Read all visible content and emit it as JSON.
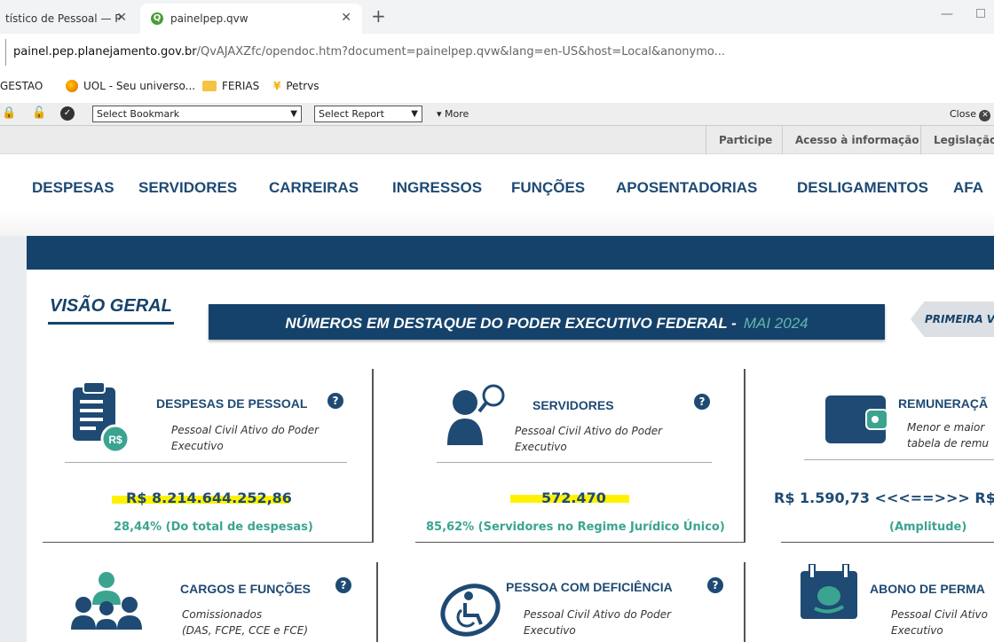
{
  "browser": {
    "tabs": [
      {
        "title": "tístico de Pessoal — P"
      },
      {
        "title": "painelpep.qvw"
      }
    ],
    "url_host": "painel.pep.planejamento.gov.br",
    "url_path": "/QvAJAXZfc/opendoc.htm?document=painelpep.qvw&lang=en-US&host=Local&anonymo...",
    "bookmarks": [
      {
        "label": "GESTAO"
      },
      {
        "label": "UOL - Seu universo..."
      },
      {
        "label": "FERIAS"
      },
      {
        "label": "Petrvs"
      }
    ]
  },
  "qv_toolbar": {
    "bookmark_select": "Select Bookmark",
    "report_select": "Select Report",
    "more": "More",
    "close": "Close"
  },
  "portal_links": [
    "Participe",
    "Acesso à informação",
    "Legislação"
  ],
  "menu": [
    "DESPESAS",
    "SERVIDORES",
    "CARREIRAS",
    "INGRESSOS",
    "FUNÇÕES",
    "APOSENTADORIAS",
    "DESLIGAMENTOS",
    "AFA"
  ],
  "visao_geral": "VISÃO GERAL",
  "banner": {
    "text": "NÚMEROS EM DESTAQUE DO PODER EXECUTIVO FEDERAL -",
    "month": "MAI 2024"
  },
  "primeira": "PRIMEIRA V",
  "cards": {
    "despesas": {
      "title": "DESPESAS DE PESSOAL",
      "sub1": "Pessoal Civil Ativo do Poder",
      "sub2": "Executivo",
      "value": "R$ 8.214.644.252,86",
      "pct": "28,44%  (Do total de despesas)"
    },
    "servidores": {
      "title": "SERVIDORES",
      "sub1": "Pessoal Civil Ativo do Poder",
      "sub2": "Executivo",
      "value": "572.470",
      "pct": "85,62%  (Servidores no Regime Jurídico Único)"
    },
    "remuneracao": {
      "title": "REMUNERAÇÃ",
      "sub1": "Menor e maior",
      "sub2": "tabela de remu",
      "value": "R$ 1.590,73  <<<==>>>  R$",
      "pct": "(Amplitude)"
    },
    "cargos": {
      "title": "CARGOS E FUNÇÕES",
      "sub1": "Comissionados",
      "sub2": "(DAS, FCPE, CCE e FCE)"
    },
    "deficiencia": {
      "title": "PESSOA COM DEFICIÊNCIA",
      "sub1": "Pessoal Civil Ativo do Poder",
      "sub2": "Executivo"
    },
    "abono": {
      "title": "ABONO DE PERMA",
      "sub1": "Pessoal Civil Ativo",
      "sub2": "Executivo"
    }
  },
  "help_glyph": "?",
  "colors": {
    "navy": "#15426b",
    "teal": "#3aa491",
    "highlight": "#fff200"
  }
}
